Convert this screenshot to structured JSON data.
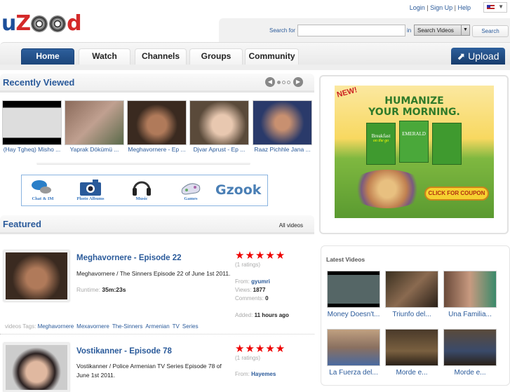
{
  "header": {
    "logo": "uZood",
    "links": [
      "Login",
      "Sign Up",
      "Help"
    ],
    "flag": "us-flag-icon"
  },
  "search": {
    "label": "Search for",
    "value": "",
    "in_label": "in",
    "scope": "Search Videos",
    "button": "Search"
  },
  "nav": {
    "tabs": [
      "Home",
      "Watch",
      "Channels",
      "Groups",
      "Community"
    ],
    "active": "Home",
    "upload": "Upload"
  },
  "recently_viewed": {
    "title": "Recently Viewed",
    "items": [
      "(Hay Tgheq) Misho ...",
      "Yaprak Dökümü ...",
      "Meghavornere - Ep ...",
      "Djvar Aprust - Ep ...",
      "Raaz Pichhle Jana ..."
    ]
  },
  "gzook": {
    "items": [
      "Chat & IM",
      "Photo Albums",
      "Music",
      "Games"
    ],
    "logo": "Gzook"
  },
  "featured": {
    "title": "Featured",
    "all_videos": "All videos",
    "videos": [
      {
        "title": "Meghavornere - Episode 22",
        "description": "Meghavornere / The Sinners Episode 22 of June 1st 2011.",
        "runtime_label": "Runtime:",
        "runtime": "35m:23s",
        "rating": 5,
        "ratings": "(1 ratings)",
        "from_label": "From:",
        "from": "gyumri",
        "views_label": "Views:",
        "views": "1877",
        "comments_label": "Comments:",
        "comments": "0",
        "added_label": "Added:",
        "added": "11 hours ago",
        "tags_label": "videos Tags:",
        "tags": [
          "Meghavornere",
          "Mexavornere",
          "The-Sinners",
          "Armenian",
          "TV",
          "Series"
        ]
      },
      {
        "title": "Vostikanner - Episode 78",
        "description": "Vostikanner / Police Armenian TV Series Episode 78 of June 1st 2011.",
        "rating": 5,
        "ratings": "(1 ratings)",
        "from_label": "From:",
        "from": "Hayemes"
      }
    ]
  },
  "ad": {
    "badge": "NEW!",
    "headline1": "HUMANIZE",
    "headline2": "YOUR MORNING.",
    "brand": "EMERALD",
    "product": "Breakfast",
    "tagline": "on the go",
    "cta": "CLICK FOR COUPON"
  },
  "latest": {
    "title": "Latest Videos",
    "items": [
      "Money Doesn't...",
      "Triunfo del...",
      "Una Familia...",
      "La Fuerza del...",
      "Morde e...",
      "Morde e..."
    ]
  }
}
